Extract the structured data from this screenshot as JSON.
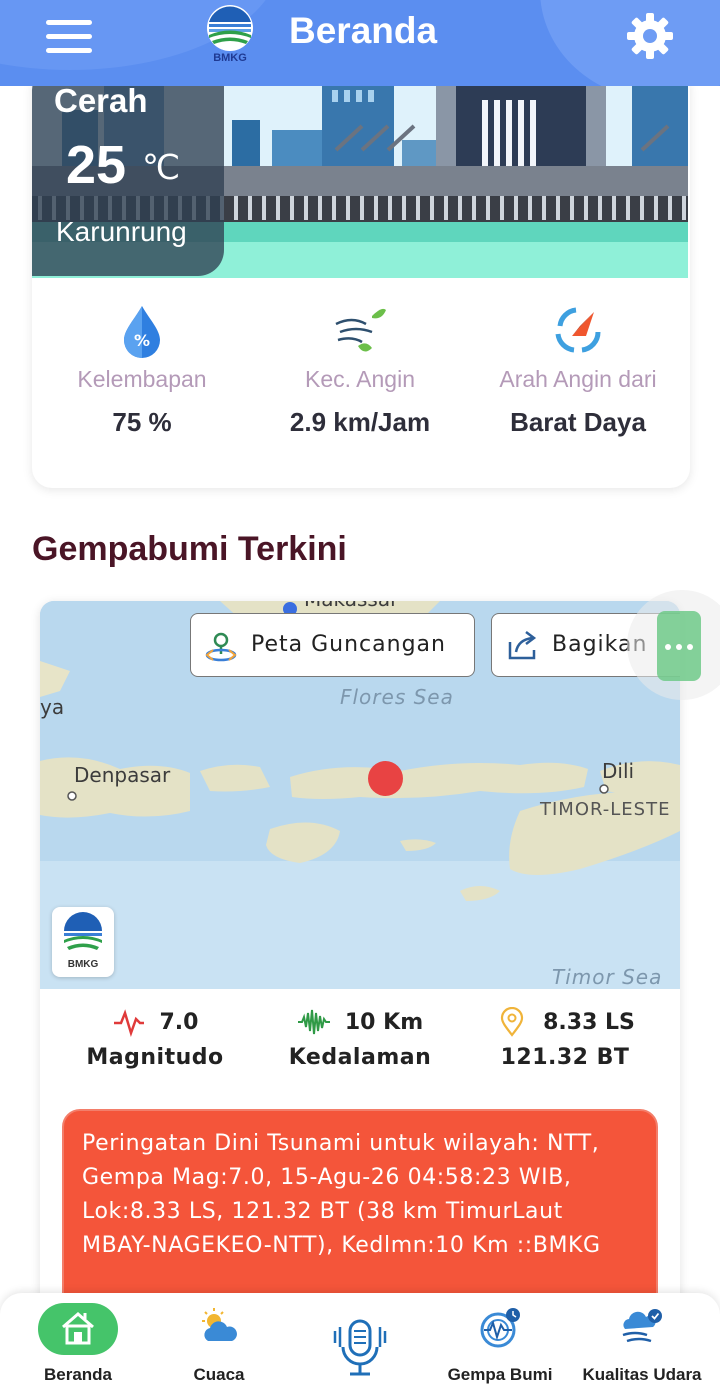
{
  "header": {
    "title": "Beranda",
    "logo_text": "BMKG",
    "menu_icon": "hamburger-menu-icon",
    "settings_icon": "gear-icon"
  },
  "weather": {
    "condition": "Cerah",
    "temperature": "25",
    "temperature_unit": "℃",
    "location": "Karunrung",
    "stats": [
      {
        "icon": "humidity-drop-icon",
        "label": "Kelembapan",
        "value": "75 %"
      },
      {
        "icon": "wind-leaves-icon",
        "label": "Kec. Angin",
        "value": "2.9 km/Jam"
      },
      {
        "icon": "wind-direction-compass-icon",
        "label": "Arah Angin dari",
        "value": "Barat Daya"
      }
    ]
  },
  "earthquake": {
    "section_title": "Gempabumi Terkini",
    "map": {
      "buttons": {
        "shake_map": "Peta Guncangan",
        "share": "Bagikan"
      },
      "labels": {
        "city1": "Makassar",
        "city2": "Denpasar",
        "city3": "Dili",
        "country": "TIMOR-LESTE",
        "edge_text": "ya",
        "sea1": "Flores Sea",
        "sea2": "Timor Sea"
      },
      "logo_text": "BMKG"
    },
    "stats": [
      {
        "icon": "magnitude-pulse-icon",
        "value": "7.0",
        "label": "Magnitudo"
      },
      {
        "icon": "seismograph-wave-icon",
        "value": "10 Km",
        "label": "Kedalaman"
      },
      {
        "icon": "location-pin-icon",
        "value": "8.33 LS",
        "label": "121.32 BT"
      }
    ],
    "tsunami_warning": "Peringatan Dini Tsunami untuk wilayah: NTT, Gempa Mag:7.0, 15-Agu-26 04:58:23 WIB, Lok:8.33 LS, 121.32 BT (38 km TimurLaut MBAY-NAGEKEO-NTT), Kedlmn:10 Km ::BMKG"
  },
  "bottom_nav": [
    {
      "label": "Beranda",
      "icon": "home-icon",
      "active": true
    },
    {
      "label": "Cuaca",
      "icon": "weather-cloud-sun-icon",
      "active": false
    },
    {
      "label": "",
      "icon": "microphone-icon",
      "active": false
    },
    {
      "label": "Gempa Bumi",
      "icon": "earthquake-icon",
      "active": false
    },
    {
      "label": "Kualitas Udara",
      "icon": "air-quality-icon",
      "active": false
    }
  ],
  "colors": {
    "header": "#5b8ef0",
    "accent_green": "#45c46a",
    "tsunami_bg": "#f4553a",
    "section_title": "#4a1526",
    "epicenter": "#e84343"
  }
}
